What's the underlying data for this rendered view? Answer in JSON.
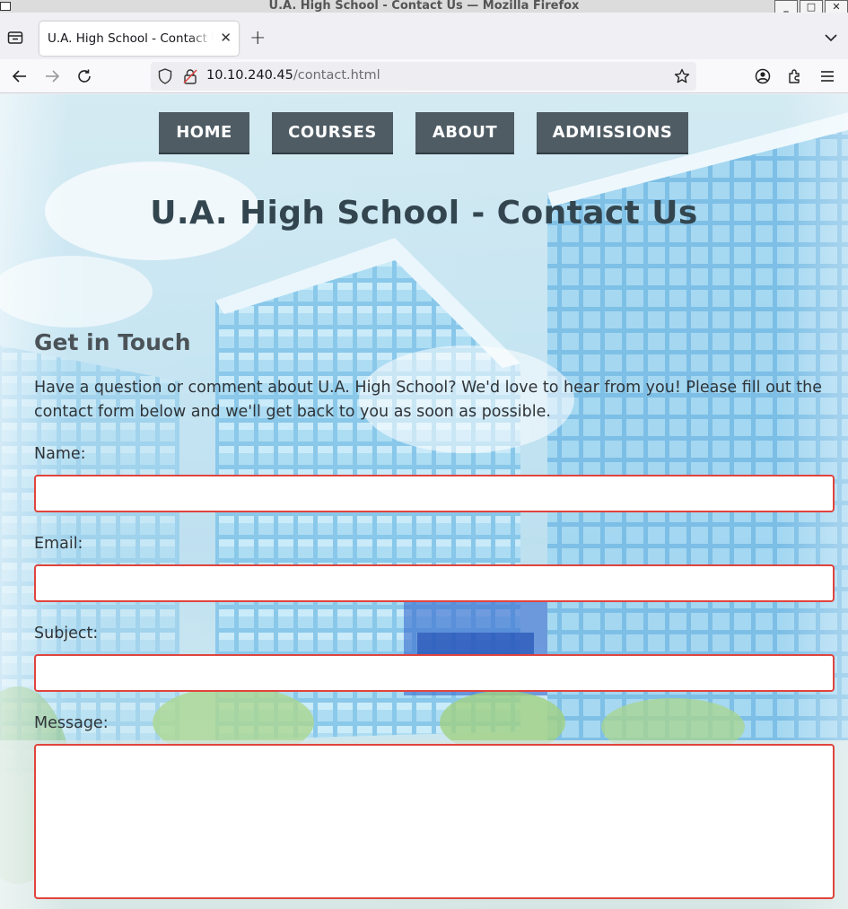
{
  "window": {
    "title": "U.A. High School - Contact Us — Mozilla Firefox",
    "min_glyph": "_",
    "max_glyph": "□",
    "close_glyph": "✕"
  },
  "tab": {
    "title": "U.A. High School - Contact Us",
    "close_glyph": "✕",
    "new_tab_glyph": "+"
  },
  "urlbar": {
    "host": "10.10.240.45",
    "path": "/contact.html"
  },
  "site_nav": {
    "items": [
      {
        "label": "HOME"
      },
      {
        "label": "COURSES"
      },
      {
        "label": "ABOUT"
      },
      {
        "label": "ADMISSIONS"
      }
    ]
  },
  "page": {
    "title": "U.A. High School - Contact Us",
    "section_title": "Get in Touch",
    "intro": "Have a question or comment about U.A. High School? We'd love to hear from you! Please fill out the contact form below and we'll get back to you as soon as possible."
  },
  "form": {
    "name_label": "Name:",
    "email_label": "Email:",
    "subject_label": "Subject:",
    "message_label": "Message:",
    "name_value": "",
    "email_value": "",
    "subject_value": "",
    "message_value": ""
  },
  "colors": {
    "nav_button": "#4f5c64",
    "heading": "#334650",
    "invalid_border": "#e0443d"
  }
}
